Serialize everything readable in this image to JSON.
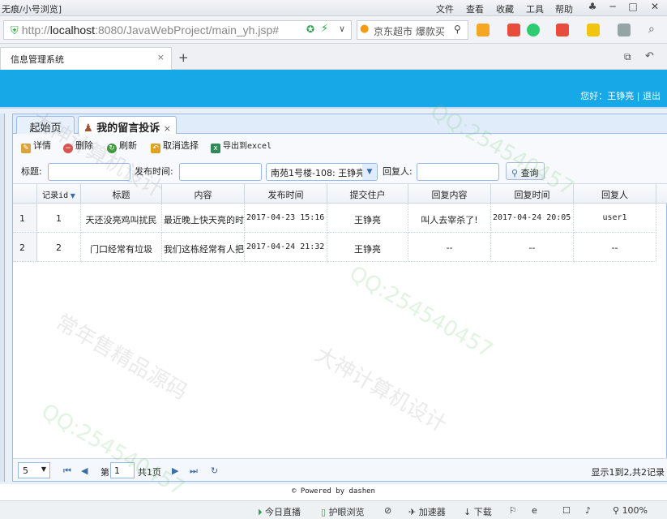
{
  "browser": {
    "window_title": "无痕/小号浏览]",
    "menus": [
      "文件",
      "查看",
      "收藏",
      "工具",
      "帮助"
    ],
    "url_prefix": "http://",
    "url_host": "localhost",
    "url_rest": ":8080/JavaWebProject/main_yh.jsp#",
    "search_text": "京东超市 爆款买",
    "tab_title": "信息管理系统",
    "tab_close": "×",
    "new_tab": "+"
  },
  "app": {
    "user_info": "您好：王铮亮 | 退出"
  },
  "tabs": [
    {
      "label": "起始页",
      "active": false
    },
    {
      "label": "我的留言投诉",
      "active": true,
      "close": "×"
    }
  ],
  "toolbar": {
    "detail": "详情",
    "delete": "删除",
    "refresh": "刷新",
    "cancel_select": "取消选择",
    "export": "导出到excel"
  },
  "search": {
    "title_label": "标题:",
    "time_label": "发布时间:",
    "select_value": "南苑1号楼-108: 王铮亮",
    "replier_label": "回复人:",
    "query_button": "查询"
  },
  "table": {
    "columns": [
      "记录id",
      "标题",
      "内容",
      "发布时间",
      "提交住户",
      "回复内容",
      "回复时间",
      "回复人"
    ],
    "rows": [
      {
        "num": "1",
        "cells": [
          "1",
          "天还没亮鸡叫扰民",
          "最近晚上快天亮的时",
          "2017-04-23 15:16",
          "王铮亮",
          "叫人去宰杀了!",
          "2017-04-24 20:05",
          "user1"
        ]
      },
      {
        "num": "2",
        "cells": [
          "2",
          "门口经常有垃圾",
          "我们这栋经常有人把",
          "2017-04-24 21:32",
          "王铮亮",
          "--",
          "--",
          "--"
        ]
      }
    ]
  },
  "pager": {
    "page_size": "5",
    "page_label": "第",
    "page_value": "1",
    "total_pages": "共1页",
    "summary": "显示1到2,共2记录"
  },
  "footer": {
    "text": "© Powered by dashen"
  },
  "statusbar": {
    "live": "今日直播",
    "protect": "护眼浏览",
    "accelerator": "加速器",
    "download": "下载",
    "zoom": "100%"
  },
  "watermarks": [
    "QQ:254540457",
    "大神计算机设计",
    "常年售精品源码"
  ],
  "colors": {
    "banner": "#16a8e7",
    "panel_border": "#99bbe8"
  }
}
